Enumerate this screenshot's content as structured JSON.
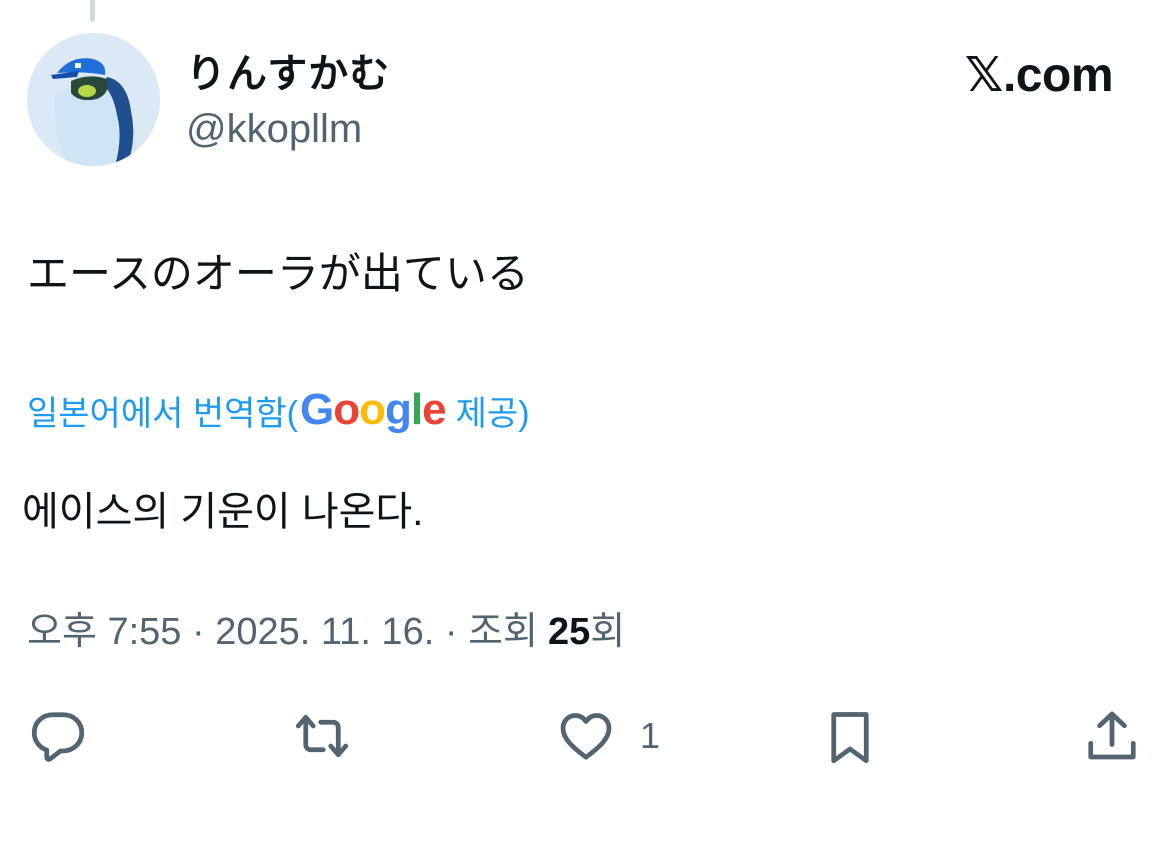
{
  "tweet": {
    "author": {
      "display_name": "りんすかむ",
      "handle": "@kkopllm"
    },
    "brand": "𝕏.com",
    "text": "エースのオーラが出ている",
    "translation": {
      "note_prefix": "일본어에서 번역함(",
      "provider_letters": [
        "G",
        "o",
        "o",
        "g",
        "l",
        "e"
      ],
      "note_suffix": " 제공)",
      "text": "에이스의 기운이 나온다."
    },
    "meta": {
      "time": "오후 7:55",
      "separator": " · ",
      "date": "2025. 11. 16.",
      "views_label": "조회",
      "views_count": "25",
      "views_suffix": "회"
    },
    "actions": {
      "reply_icon": "reply-icon",
      "retweet_icon": "retweet-icon",
      "like_icon": "heart-icon",
      "like_count": "1",
      "bookmark_icon": "bookmark-icon",
      "share_icon": "share-icon"
    }
  },
  "colors": {
    "text": "#0f1419",
    "secondary": "#536471",
    "link": "#1d9bf0",
    "google_blue": "#4285f4",
    "google_red": "#ea4335",
    "google_yellow": "#fbbc05",
    "google_green": "#34a853"
  }
}
